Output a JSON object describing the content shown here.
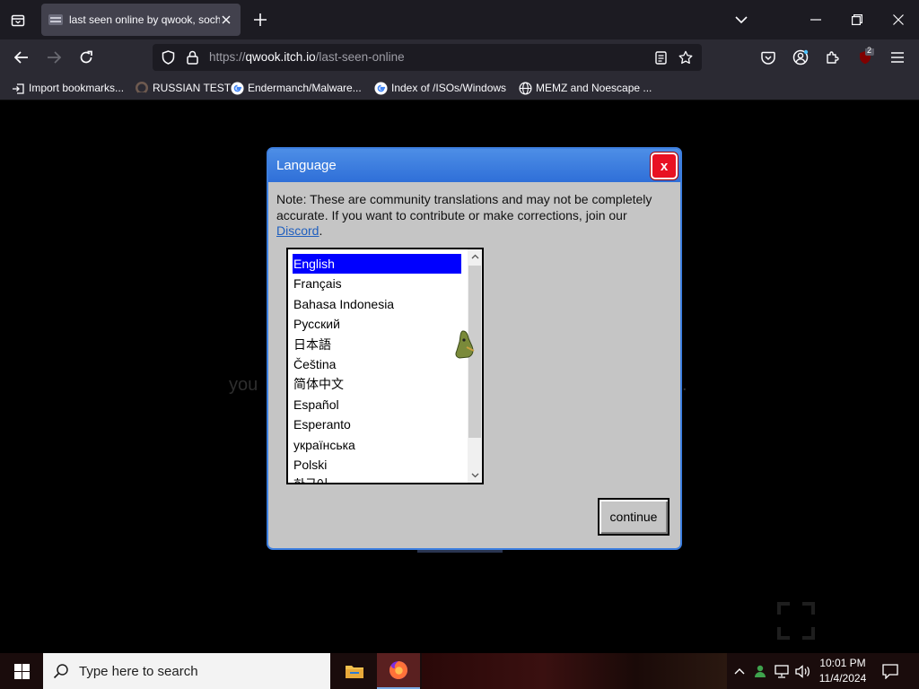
{
  "browser": {
    "tab": {
      "title": "last seen online by qwook, sochi"
    },
    "url": {
      "scheme": "https://",
      "host": "qwook.itch.io",
      "path": "/last-seen-online"
    },
    "extension_badge": "2",
    "bookmarks": [
      {
        "label": "Import bookmarks...",
        "icon": "import-icon"
      },
      {
        "label": "RUSSIAN TEST",
        "icon": "github-icon"
      },
      {
        "label": "Endermanch/Malware...",
        "icon": "google-icon"
      },
      {
        "label": "Index of /ISOs/Windows",
        "icon": "google-icon"
      },
      {
        "label": "MEMZ and Noescape ...",
        "icon": "globe-icon"
      }
    ]
  },
  "page": {
    "bg_text_left": "you",
    "bg_text_right": "."
  },
  "dialog": {
    "title": "Language",
    "close_label": "x",
    "note_text": "Note: These are community translations and may not be completely accurate. If you want to contribute or make corrections, join our ",
    "note_link": "Discord",
    "note_end": ".",
    "languages": [
      "English",
      "Français",
      "Bahasa Indonesia",
      "Русский",
      "日本語",
      "Čeština",
      "简体中文",
      "Español",
      "Esperanto",
      "українська",
      "Polski",
      "한국어"
    ],
    "selected_language": "English",
    "continue_label": "continue"
  },
  "taskbar": {
    "search_placeholder": "Type here to search",
    "time": "10:01 PM",
    "date": "11/4/2024"
  },
  "colors": {
    "dialog_title_bg": "#3a7be0",
    "dialog_bg": "#c5c5c5",
    "selected_item_bg": "#0000ff",
    "close_button_bg": "#e81123"
  }
}
